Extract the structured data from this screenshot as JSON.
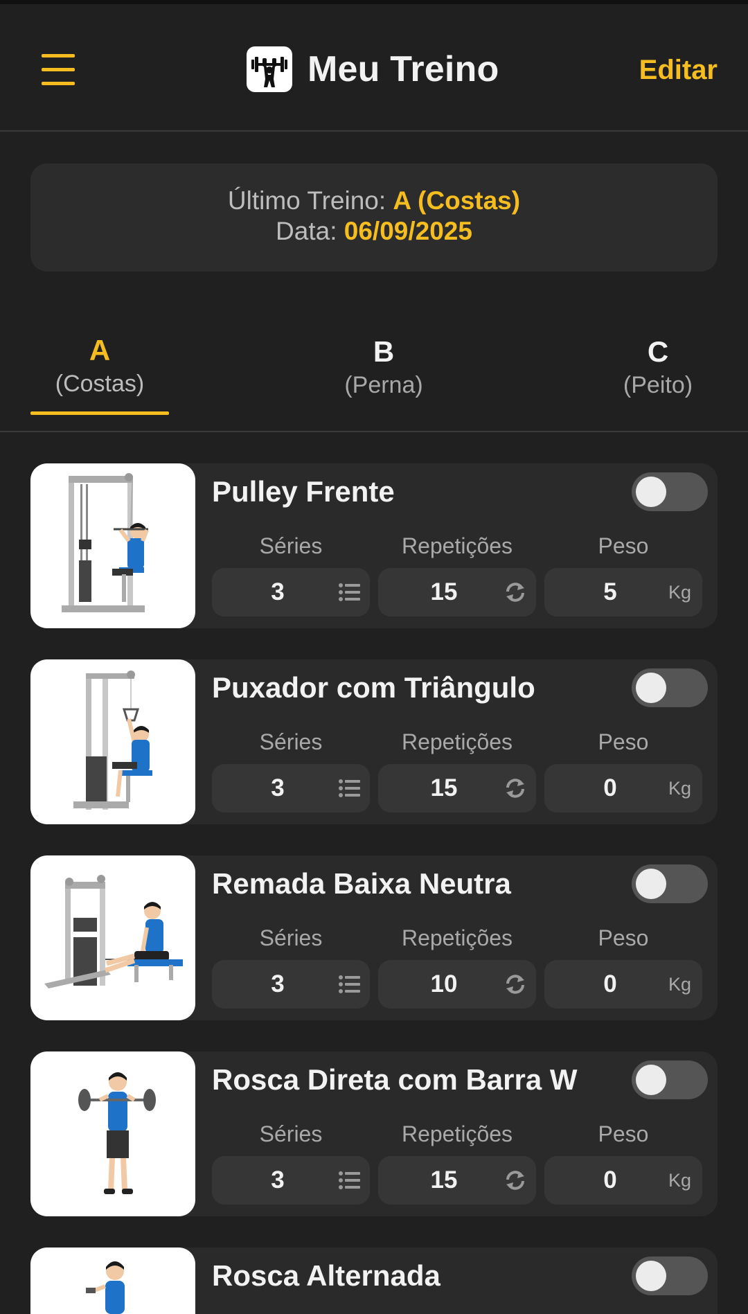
{
  "header": {
    "title": "Meu Treino",
    "edit_label": "Editar",
    "menu_icon": "hamburger-menu-icon",
    "logo_icon": "weightlifter-icon"
  },
  "last_workout": {
    "label": "Último Treino:",
    "value": "A (Costas)",
    "date_label": "Data:",
    "date_value": "06/09/2025"
  },
  "tabs": [
    {
      "letter": "A",
      "name": "(Costas)",
      "active": true
    },
    {
      "letter": "B",
      "name": "(Perna)",
      "active": false
    },
    {
      "letter": "C",
      "name": "(Peito)",
      "active": false
    }
  ],
  "labels": {
    "series": "Séries",
    "reps": "Repetições",
    "weight": "Peso",
    "unit": "Kg"
  },
  "exercises": [
    {
      "name": "Pulley Frente",
      "series": "3",
      "reps": "15",
      "weight": "5",
      "done": false,
      "image": "lat-pulldown-machine"
    },
    {
      "name": "Puxador com Triângulo",
      "series": "3",
      "reps": "15",
      "weight": "0",
      "done": false,
      "image": "triangle-pulldown-machine"
    },
    {
      "name": "Remada Baixa Neutra",
      "series": "3",
      "reps": "10",
      "weight": "0",
      "done": false,
      "image": "seated-cable-row"
    },
    {
      "name": "Rosca Direta com Barra W",
      "series": "3",
      "reps": "15",
      "weight": "0",
      "done": false,
      "image": "ez-bar-curl"
    },
    {
      "name": "Rosca Alternada",
      "series": "",
      "reps": "",
      "weight": "",
      "done": false,
      "image": "alternating-dumbbell-curl"
    }
  ],
  "colors": {
    "background": "#202020",
    "card": "#2a2a2a",
    "accent": "#f5bd1f",
    "field": "#363636",
    "toggle_off": "#555555"
  }
}
